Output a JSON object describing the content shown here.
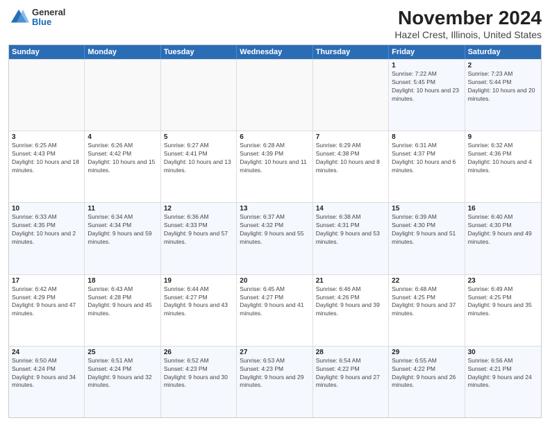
{
  "app": {
    "logo_general": "General",
    "logo_blue": "Blue"
  },
  "title": "November 2024",
  "subtitle": "Hazel Crest, Illinois, United States",
  "weekdays": [
    "Sunday",
    "Monday",
    "Tuesday",
    "Wednesday",
    "Thursday",
    "Friday",
    "Saturday"
  ],
  "rows": [
    [
      {
        "day": "",
        "info": ""
      },
      {
        "day": "",
        "info": ""
      },
      {
        "day": "",
        "info": ""
      },
      {
        "day": "",
        "info": ""
      },
      {
        "day": "",
        "info": ""
      },
      {
        "day": "1",
        "info": "Sunrise: 7:22 AM\nSunset: 5:45 PM\nDaylight: 10 hours and 23 minutes."
      },
      {
        "day": "2",
        "info": "Sunrise: 7:23 AM\nSunset: 5:44 PM\nDaylight: 10 hours and 20 minutes."
      }
    ],
    [
      {
        "day": "3",
        "info": "Sunrise: 6:25 AM\nSunset: 4:43 PM\nDaylight: 10 hours and 18 minutes."
      },
      {
        "day": "4",
        "info": "Sunrise: 6:26 AM\nSunset: 4:42 PM\nDaylight: 10 hours and 15 minutes."
      },
      {
        "day": "5",
        "info": "Sunrise: 6:27 AM\nSunset: 4:41 PM\nDaylight: 10 hours and 13 minutes."
      },
      {
        "day": "6",
        "info": "Sunrise: 6:28 AM\nSunset: 4:39 PM\nDaylight: 10 hours and 11 minutes."
      },
      {
        "day": "7",
        "info": "Sunrise: 6:29 AM\nSunset: 4:38 PM\nDaylight: 10 hours and 8 minutes."
      },
      {
        "day": "8",
        "info": "Sunrise: 6:31 AM\nSunset: 4:37 PM\nDaylight: 10 hours and 6 minutes."
      },
      {
        "day": "9",
        "info": "Sunrise: 6:32 AM\nSunset: 4:36 PM\nDaylight: 10 hours and 4 minutes."
      }
    ],
    [
      {
        "day": "10",
        "info": "Sunrise: 6:33 AM\nSunset: 4:35 PM\nDaylight: 10 hours and 2 minutes."
      },
      {
        "day": "11",
        "info": "Sunrise: 6:34 AM\nSunset: 4:34 PM\nDaylight: 9 hours and 59 minutes."
      },
      {
        "day": "12",
        "info": "Sunrise: 6:36 AM\nSunset: 4:33 PM\nDaylight: 9 hours and 57 minutes."
      },
      {
        "day": "13",
        "info": "Sunrise: 6:37 AM\nSunset: 4:32 PM\nDaylight: 9 hours and 55 minutes."
      },
      {
        "day": "14",
        "info": "Sunrise: 6:38 AM\nSunset: 4:31 PM\nDaylight: 9 hours and 53 minutes."
      },
      {
        "day": "15",
        "info": "Sunrise: 6:39 AM\nSunset: 4:30 PM\nDaylight: 9 hours and 51 minutes."
      },
      {
        "day": "16",
        "info": "Sunrise: 6:40 AM\nSunset: 4:30 PM\nDaylight: 9 hours and 49 minutes."
      }
    ],
    [
      {
        "day": "17",
        "info": "Sunrise: 6:42 AM\nSunset: 4:29 PM\nDaylight: 9 hours and 47 minutes."
      },
      {
        "day": "18",
        "info": "Sunrise: 6:43 AM\nSunset: 4:28 PM\nDaylight: 9 hours and 45 minutes."
      },
      {
        "day": "19",
        "info": "Sunrise: 6:44 AM\nSunset: 4:27 PM\nDaylight: 9 hours and 43 minutes."
      },
      {
        "day": "20",
        "info": "Sunrise: 6:45 AM\nSunset: 4:27 PM\nDaylight: 9 hours and 41 minutes."
      },
      {
        "day": "21",
        "info": "Sunrise: 6:46 AM\nSunset: 4:26 PM\nDaylight: 9 hours and 39 minutes."
      },
      {
        "day": "22",
        "info": "Sunrise: 6:48 AM\nSunset: 4:25 PM\nDaylight: 9 hours and 37 minutes."
      },
      {
        "day": "23",
        "info": "Sunrise: 6:49 AM\nSunset: 4:25 PM\nDaylight: 9 hours and 35 minutes."
      }
    ],
    [
      {
        "day": "24",
        "info": "Sunrise: 6:50 AM\nSunset: 4:24 PM\nDaylight: 9 hours and 34 minutes."
      },
      {
        "day": "25",
        "info": "Sunrise: 6:51 AM\nSunset: 4:24 PM\nDaylight: 9 hours and 32 minutes."
      },
      {
        "day": "26",
        "info": "Sunrise: 6:52 AM\nSunset: 4:23 PM\nDaylight: 9 hours and 30 minutes."
      },
      {
        "day": "27",
        "info": "Sunrise: 6:53 AM\nSunset: 4:23 PM\nDaylight: 9 hours and 29 minutes."
      },
      {
        "day": "28",
        "info": "Sunrise: 6:54 AM\nSunset: 4:22 PM\nDaylight: 9 hours and 27 minutes."
      },
      {
        "day": "29",
        "info": "Sunrise: 6:55 AM\nSunset: 4:22 PM\nDaylight: 9 hours and 26 minutes."
      },
      {
        "day": "30",
        "info": "Sunrise: 6:56 AM\nSunset: 4:21 PM\nDaylight: 9 hours and 24 minutes."
      }
    ]
  ]
}
